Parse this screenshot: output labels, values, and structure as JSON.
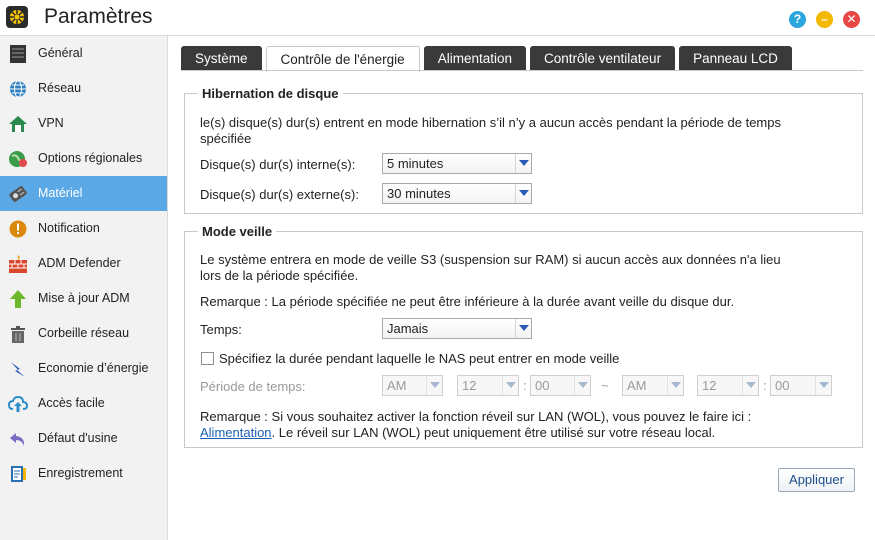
{
  "app": {
    "title": "Paramètres",
    "help_label": "?",
    "minimize_label": "–",
    "close_label": "✕"
  },
  "sidebar": {
    "items": [
      {
        "label": "Général",
        "icon": "server-icon"
      },
      {
        "label": "Réseau",
        "icon": "globe-icon"
      },
      {
        "label": "VPN",
        "icon": "vpn-house-icon"
      },
      {
        "label": "Options régionales",
        "icon": "region-globe-icon"
      },
      {
        "label": "Matériel",
        "icon": "hardware-disk-icon"
      },
      {
        "label": "Notification",
        "icon": "alert-icon"
      },
      {
        "label": "ADM Defender",
        "icon": "firewall-icon"
      },
      {
        "label": "Mise à jour ADM",
        "icon": "update-arrow-icon"
      },
      {
        "label": "Corbeille réseau",
        "icon": "trash-icon"
      },
      {
        "label": "Economie d’énergie",
        "icon": "energy-bolt-icon"
      },
      {
        "label": "Accès facile",
        "icon": "cloud-upload-icon"
      },
      {
        "label": "Défaut d'usine",
        "icon": "back-arrow-icon"
      },
      {
        "label": "Enregistrement",
        "icon": "registration-icon"
      }
    ],
    "active_index": 4
  },
  "tabs": [
    {
      "label": "Système",
      "active": false
    },
    {
      "label": "Contrôle de l'énergie",
      "active": true
    },
    {
      "label": "Alimentation",
      "active": false
    },
    {
      "label": "Contrôle ventilateur",
      "active": false
    },
    {
      "label": "Panneau LCD",
      "active": false
    }
  ],
  "hibernation": {
    "legend": "Hibernation de disque",
    "description_1": "le(s) disque(s) dur(s) entrent en mode hibernation s’il n’y a aucun accès pendant la période de temps",
    "description_2": "spécifiée",
    "internal_label": "Disque(s) dur(s) interne(s):",
    "internal_value": "5 minutes",
    "external_label": "Disque(s) dur(s) externe(s):",
    "external_value": "30 minutes"
  },
  "standby": {
    "legend": "Mode veille",
    "description_1": "Le système entrera en mode de veille S3 (suspension sur RAM) si aucun accès aux données n'a lieu",
    "description_2": "lors de la période spécifiée.",
    "remark": "Remarque : La période spécifiée ne peut être inférieure à la durée avant veille du disque dur.",
    "time_label": "Temps:",
    "time_value": "Jamais",
    "checkbox_label": "Spécifiez la durée pendant laquelle le NAS peut entrer en mode veille",
    "checkbox_checked": false,
    "period_label": "Période de temps:",
    "start_ampm": "AM",
    "start_hour": "12",
    "start_minute": "00",
    "range_sep": "~",
    "end_ampm": "AM",
    "end_hour": "12",
    "end_minute": "00",
    "colon": ":",
    "wol_remark_1": "Remarque : Si vous souhaitez activer la fonction réveil sur LAN (WOL), vous pouvez le faire ici :",
    "wol_link": "Alimentation",
    "wol_remark_2": ". Le réveil sur LAN (WOL) peut uniquement être utilisé sur votre réseau local."
  },
  "apply_label": "Appliquer",
  "colors": {
    "sidebar_active": "#5aa9e6",
    "tab_dark": "#3a3a3a",
    "link": "#1a5fb4"
  }
}
